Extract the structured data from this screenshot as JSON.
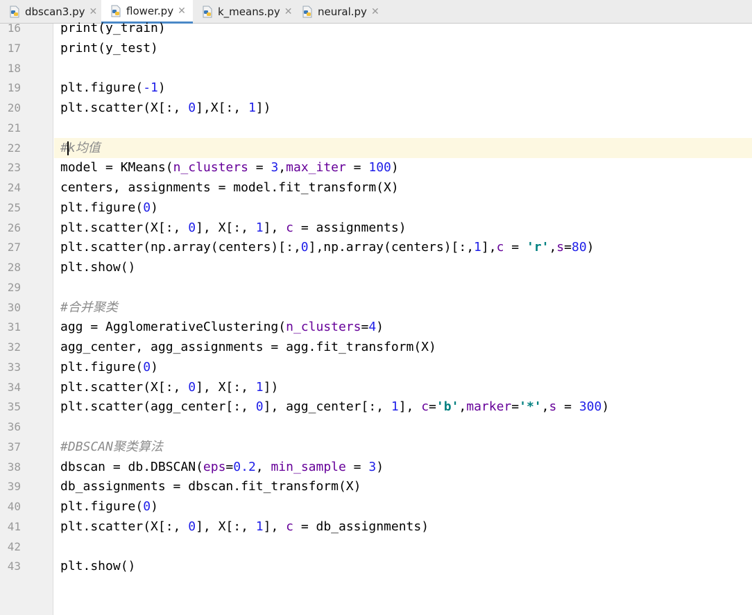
{
  "tabs": [
    {
      "label": "dbscan3.py",
      "active": false
    },
    {
      "label": "flower.py",
      "active": true
    },
    {
      "label": "k_means.py",
      "active": false
    },
    {
      "label": "neural.py",
      "active": false
    }
  ],
  "current_line": "22",
  "lines": [
    {
      "n": "16",
      "code": "print(y_train)"
    },
    {
      "n": "17",
      "code": "print(y_test)"
    },
    {
      "n": "18",
      "code": ""
    },
    {
      "n": "19",
      "code": "plt.figure(-1)"
    },
    {
      "n": "20",
      "code": "plt.scatter(X[:, 0],X[:, 1])"
    },
    {
      "n": "21",
      "code": ""
    },
    {
      "n": "22",
      "code": "#k均值"
    },
    {
      "n": "23",
      "code": "model = KMeans(n_clusters = 3,max_iter = 100)"
    },
    {
      "n": "24",
      "code": "centers, assignments = model.fit_transform(X)"
    },
    {
      "n": "25",
      "code": "plt.figure(0)"
    },
    {
      "n": "26",
      "code": "plt.scatter(X[:, 0], X[:, 1], c = assignments)"
    },
    {
      "n": "27",
      "code": "plt.scatter(np.array(centers)[:,0],np.array(centers)[:,1],c = 'r',s=80)"
    },
    {
      "n": "28",
      "code": "plt.show()"
    },
    {
      "n": "29",
      "code": ""
    },
    {
      "n": "30",
      "code": "#合并聚类"
    },
    {
      "n": "31",
      "code": "agg = AgglomerativeClustering(n_clusters=4)"
    },
    {
      "n": "32",
      "code": "agg_center, agg_assignments = agg.fit_transform(X)"
    },
    {
      "n": "33",
      "code": "plt.figure(0)"
    },
    {
      "n": "34",
      "code": "plt.scatter(X[:, 0], X[:, 1])"
    },
    {
      "n": "35",
      "code": "plt.scatter(agg_center[:, 0], agg_center[:, 1], c='b',marker='*',s = 300)"
    },
    {
      "n": "36",
      "code": ""
    },
    {
      "n": "37",
      "code": "#DBSCAN聚类算法"
    },
    {
      "n": "38",
      "code": "dbscan = db.DBSCAN(eps=0.2, min_sample = 3)"
    },
    {
      "n": "39",
      "code": "db_assignments = dbscan.fit_transform(X)"
    },
    {
      "n": "40",
      "code": "plt.figure(0)"
    },
    {
      "n": "41",
      "code": "plt.scatter(X[:, 0], X[:, 1], c = db_assignments)"
    },
    {
      "n": "42",
      "code": ""
    },
    {
      "n": "43",
      "code": "plt.show()"
    }
  ],
  "icons": {
    "tab": "python-file-icon",
    "close": "close-icon"
  },
  "colors": {
    "number": "#1e1ee8",
    "keyword_arg": "#660099",
    "string": "#008080",
    "comment": "#8c8c8c",
    "current_line": "#fdf8e1",
    "active_tab_underline": "#4a88c7"
  }
}
